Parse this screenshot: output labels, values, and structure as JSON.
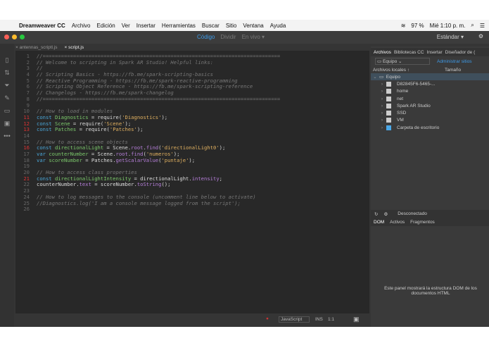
{
  "menubar": {
    "app": "Dreamweaver CC",
    "items": [
      "Archivo",
      "Edición",
      "Ver",
      "Insertar",
      "Herramientas",
      "Buscar",
      "Sitio",
      "Ventana",
      "Ayuda"
    ],
    "battery": "97 %",
    "clock": "Mié 1:10 p. m."
  },
  "toolbar": {
    "views": [
      "Código",
      "Dividir",
      "En vivo ▾"
    ],
    "workspace": "Estándar ▾"
  },
  "tabs": [
    "antennas_scriptl.js",
    "script.js"
  ],
  "code": {
    "error_lines": [
      11,
      12,
      13,
      16,
      21
    ],
    "lines": [
      [
        [
          "comment",
          "//=============================================================================="
        ]
      ],
      [
        [
          "comment",
          "// Welcome to scripting in Spark AR Studio! Helpful links:"
        ]
      ],
      [
        [
          "comment",
          "//"
        ]
      ],
      [
        [
          "comment",
          "// Scripting Basics - https://fb.me/spark-scripting-basics"
        ]
      ],
      [
        [
          "comment",
          "// Reactive Programming - https://fb.me/spark-reactive-programming"
        ]
      ],
      [
        [
          "comment",
          "// Scripting Object Reference - https://fb.me/spark-scripting-reference"
        ]
      ],
      [
        [
          "comment",
          "// Changelogs - https://fb.me/spark-changelog"
        ]
      ],
      [
        [
          "comment",
          "//=============================================================================="
        ]
      ],
      [],
      [
        [
          "comment",
          "// How to load in modules"
        ]
      ],
      [
        [
          "kw",
          "const "
        ],
        [
          "var",
          "Diagnostics"
        ],
        [
          "plain",
          " = require("
        ],
        [
          "str",
          "'Diagnostics'"
        ],
        [
          "plain",
          ");"
        ]
      ],
      [
        [
          "kw",
          "const "
        ],
        [
          "var",
          "Scene"
        ],
        [
          "plain",
          " = require("
        ],
        [
          "str",
          "'Scene'"
        ],
        [
          "plain",
          ");"
        ]
      ],
      [
        [
          "kw",
          "const "
        ],
        [
          "var",
          "Patches"
        ],
        [
          "plain",
          " = require("
        ],
        [
          "str",
          "'Patches'"
        ],
        [
          "plain",
          ");"
        ]
      ],
      [],
      [
        [
          "comment",
          "// How to access scene objects"
        ]
      ],
      [
        [
          "kw",
          "const "
        ],
        [
          "var",
          "directionalLight"
        ],
        [
          "plain",
          " = Scene."
        ],
        [
          "prop",
          "root"
        ],
        [
          "plain",
          "."
        ],
        [
          "prop",
          "find"
        ],
        [
          "plain",
          "("
        ],
        [
          "str",
          "'directionalLight0'"
        ],
        [
          "plain",
          ");"
        ]
      ],
      [
        [
          "kw",
          "var "
        ],
        [
          "var",
          "counterNumber"
        ],
        [
          "plain",
          " = Scene."
        ],
        [
          "prop",
          "root"
        ],
        [
          "plain",
          "."
        ],
        [
          "prop",
          "find"
        ],
        [
          "plain",
          "("
        ],
        [
          "str",
          "'numeros'"
        ],
        [
          "plain",
          ");"
        ]
      ],
      [
        [
          "kw",
          "var "
        ],
        [
          "var",
          "scoreNumber"
        ],
        [
          "plain",
          " = Patches."
        ],
        [
          "prop",
          "getScalarValue"
        ],
        [
          "plain",
          "("
        ],
        [
          "str",
          "'puntaje'"
        ],
        [
          "plain",
          ");"
        ]
      ],
      [],
      [
        [
          "comment",
          "// How to access class properties"
        ]
      ],
      [
        [
          "kw",
          "const "
        ],
        [
          "var",
          "directionalLightIntensity"
        ],
        [
          "plain",
          " = directionalLight."
        ],
        [
          "prop",
          "intensity"
        ],
        [
          "plain",
          ";"
        ]
      ],
      [
        [
          "plain",
          "counterNumber."
        ],
        [
          "prop",
          "text"
        ],
        [
          "plain",
          " = scoreNumber."
        ],
        [
          "prop",
          "toString"
        ],
        [
          "plain",
          "();"
        ]
      ],
      [],
      [
        [
          "comment",
          "// How to log messages to the console (uncomment line below to activate)"
        ]
      ],
      [
        [
          "comment",
          "//Diagnostics.log('I am a console message logged from the script');"
        ]
      ],
      []
    ]
  },
  "status": {
    "language": "JavaScript",
    "mode": "INS",
    "position": "1:1"
  },
  "panel": {
    "tabs": [
      "Archivos",
      "Bibliotecas CC",
      "Insertar",
      "Diseñador de ("
    ],
    "site": "Equipo",
    "manage": "Administrar sitios",
    "col_local": "Archivos locales ↑",
    "col_size": "Tamaño",
    "root": "Equipo",
    "items": [
      {
        "name": "D82845F6-5465-...",
        "type": "drive"
      },
      {
        "name": "home",
        "type": "drive"
      },
      {
        "name": "net",
        "type": "drive"
      },
      {
        "name": "Spark AR Studio",
        "type": "volume"
      },
      {
        "name": "SSD",
        "type": "drive"
      },
      {
        "name": "VM",
        "type": "drive"
      },
      {
        "name": "Carpeta de escritorio",
        "type": "folder"
      }
    ],
    "connection": "Desconectado",
    "dom_tabs": [
      "DOM",
      "Activos",
      "Fragmentos"
    ],
    "dom_message": "Este panel mostrará la estructura DOM de los documentos HTML"
  }
}
